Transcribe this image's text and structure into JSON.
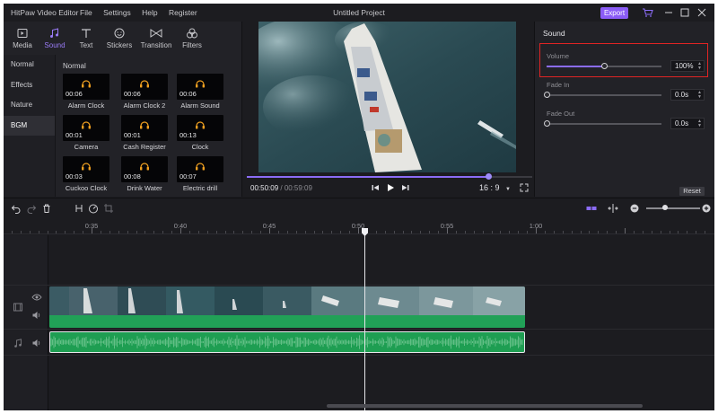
{
  "titlebar": {
    "app_name": "HitPaw Video Editor",
    "menu": [
      "File",
      "Settings",
      "Help",
      "Register"
    ],
    "document_title": "Untitled Project",
    "export_label": "Export"
  },
  "media_tabs": [
    {
      "label": "Media",
      "icon": "media-icon"
    },
    {
      "label": "Sound",
      "icon": "music-note-icon",
      "active": true
    },
    {
      "label": "Text",
      "icon": "text-icon"
    },
    {
      "label": "Stickers",
      "icon": "sticker-icon"
    },
    {
      "label": "Transition",
      "icon": "transition-icon"
    },
    {
      "label": "Filters",
      "icon": "filters-icon"
    }
  ],
  "categories": [
    {
      "label": "Normal"
    },
    {
      "label": "Effects"
    },
    {
      "label": "Nature"
    },
    {
      "label": "BGM",
      "active": true
    }
  ],
  "section_label": "Normal",
  "sound_items": [
    {
      "duration": "00:06",
      "name": "Alarm Clock"
    },
    {
      "duration": "00:06",
      "name": "Alarm Clock 2"
    },
    {
      "duration": "00:06",
      "name": "Alarm Sound"
    },
    {
      "duration": "00:01",
      "name": "Camera"
    },
    {
      "duration": "00:01",
      "name": "Cash Register"
    },
    {
      "duration": "00:13",
      "name": "Clock"
    },
    {
      "duration": "00:03",
      "name": "Cuckoo Clock"
    },
    {
      "duration": "00:08",
      "name": "Drink Water"
    },
    {
      "duration": "00:07",
      "name": "Electric drill"
    }
  ],
  "preview": {
    "current_time": "00:50:09",
    "separator": " / ",
    "total_time": "00:59:09",
    "progress": 0.848,
    "aspect_ratio": "16 : 9"
  },
  "sound_panel": {
    "title": "Sound",
    "volume_label": "Volume",
    "volume_value": "100%",
    "volume_level": 0.5,
    "fade_in_label": "Fade In",
    "fade_in_value": "0.0s",
    "fade_out_label": "Fade Out",
    "fade_out_value": "0.0s",
    "reset_label": "Reset"
  },
  "timeline": {
    "ruler_labels": [
      "0:35",
      "0:40",
      "0:45",
      "0:50",
      "0:55",
      "1:00"
    ],
    "zoom_level": 0.35
  },
  "colors": {
    "accent": "#8b5cf6",
    "clip_green": "#21a157",
    "highlight_box": "#e02424"
  }
}
